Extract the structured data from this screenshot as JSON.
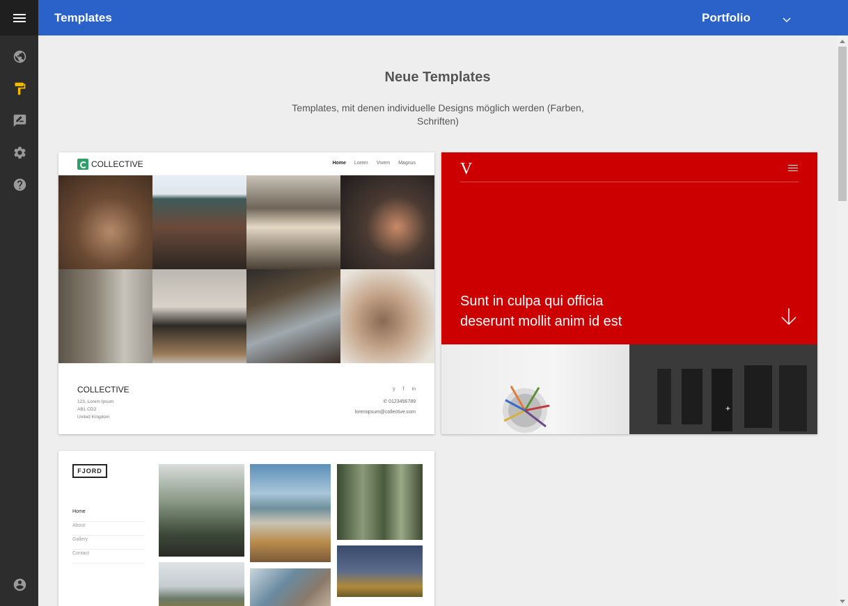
{
  "header": {
    "title": "Templates",
    "site_selector": "Portfolio"
  },
  "sidebar": {
    "items": [
      {
        "icon": "globe-icon"
      },
      {
        "icon": "paint-roller-icon",
        "active": true,
        "active_color": "#f5b800"
      },
      {
        "icon": "edit-note-icon"
      },
      {
        "icon": "settings-icon"
      },
      {
        "icon": "help-icon"
      },
      {
        "icon": "account-icon"
      }
    ]
  },
  "main": {
    "heading": "Neue Templates",
    "subheading": "Templates, mit denen individuelle Designs möglich werden (Farben, Schriften)"
  },
  "templates": {
    "collective": {
      "brand": "COLLECTIVE",
      "nav": [
        "Home",
        "Lorem",
        "Vivem",
        "Magnus"
      ],
      "footer_brand": "COLLECTIVE",
      "address_line1": "123, Lorem Ipsum",
      "address_line2": "AB1 CD2",
      "address_line3": "United Kingdom",
      "social": [
        "y",
        "f",
        "in"
      ],
      "phone": "0123456789",
      "email": "loremipsum@collective.com"
    },
    "vivem": {
      "logo": "V",
      "tagline_line1": "Sunt in culpa qui officia",
      "tagline_line2": "deserunt mollit anim id est",
      "accent": "#cc0000"
    },
    "fjord": {
      "logo": "FJORD",
      "nav": [
        "Home",
        "About",
        "Gallery",
        "Contact"
      ]
    }
  },
  "colors": {
    "header": "#2b62c9",
    "sidebar": "#2d2d2d",
    "background": "#eeeeee"
  }
}
